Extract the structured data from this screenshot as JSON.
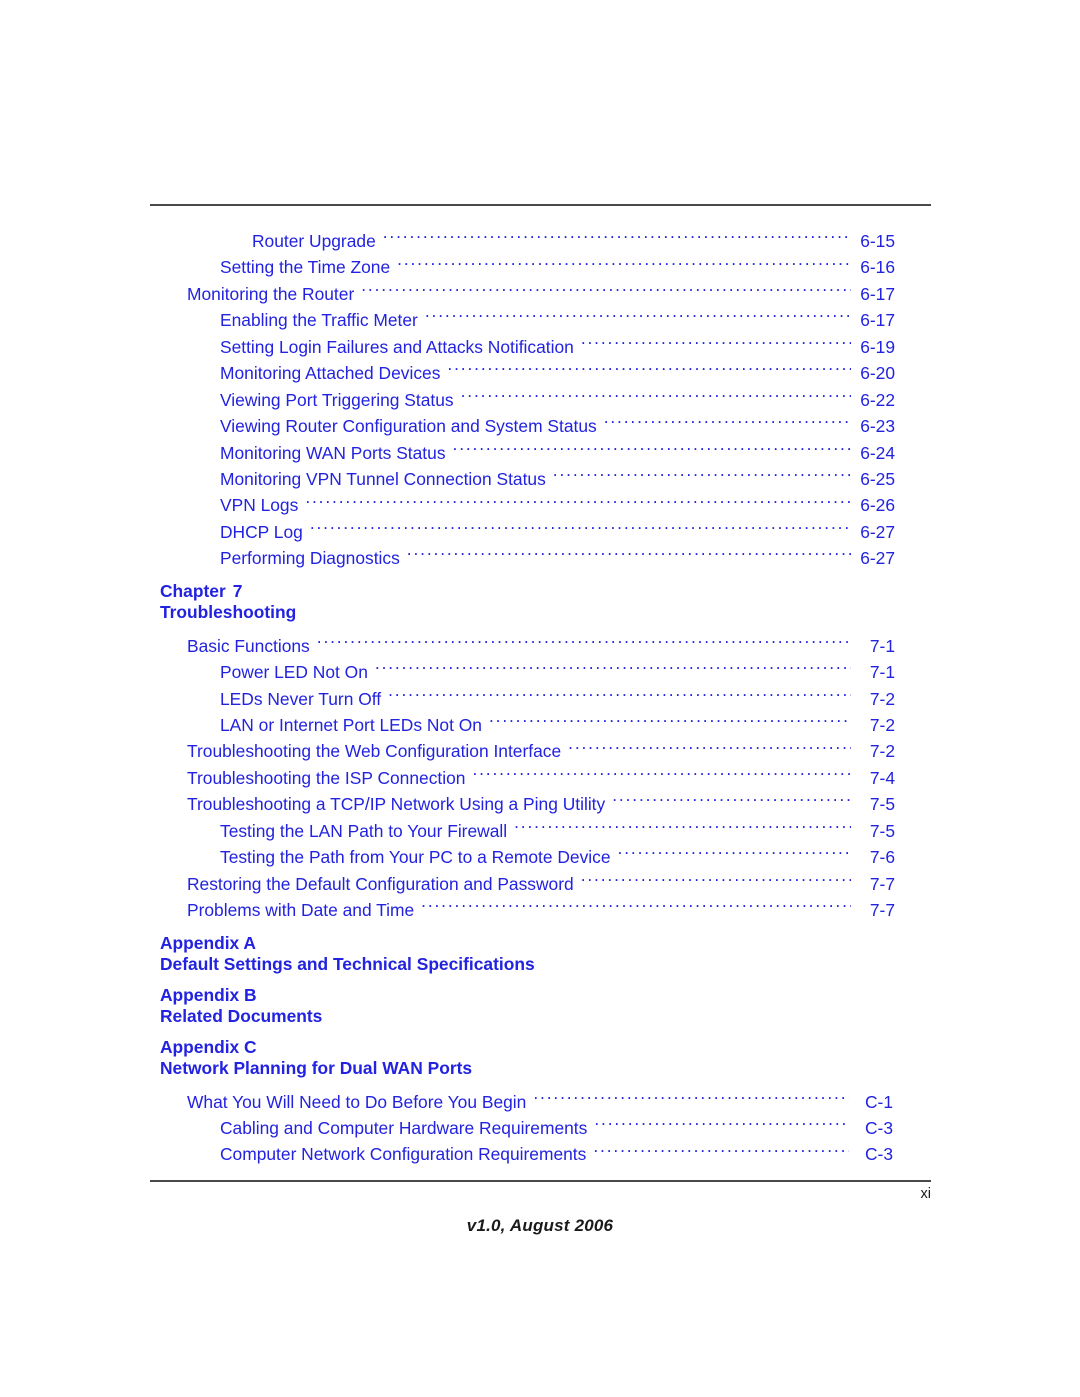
{
  "document": {
    "folio": "xi",
    "version_line": "v1.0, August 2006",
    "link_color": "#2222e0",
    "rule_color": "#4a4a4a"
  },
  "toc": {
    "entries": [
      {
        "kind": "entry",
        "level": 3,
        "title": "Router Upgrade",
        "page": "6-15"
      },
      {
        "kind": "entry",
        "level": 2,
        "title": "Setting the Time Zone",
        "page": "6-16"
      },
      {
        "kind": "entry",
        "level": 1,
        "title": "Monitoring the Router",
        "page": "6-17"
      },
      {
        "kind": "entry",
        "level": 2,
        "title": "Enabling the Traffic Meter",
        "page": "6-17"
      },
      {
        "kind": "entry",
        "level": 2,
        "title": "Setting Login Failures and Attacks Notification",
        "page": "6-19"
      },
      {
        "kind": "entry",
        "level": 2,
        "title": "Monitoring Attached Devices",
        "page": "6-20"
      },
      {
        "kind": "entry",
        "level": 2,
        "title": "Viewing Port Triggering Status",
        "page": "6-22"
      },
      {
        "kind": "entry",
        "level": 2,
        "title": "Viewing Router Configuration and System Status",
        "page": "6-23"
      },
      {
        "kind": "entry",
        "level": 2,
        "title": "Monitoring WAN Ports Status",
        "page": "6-24"
      },
      {
        "kind": "entry",
        "level": 2,
        "title": "Monitoring VPN Tunnel Connection Status",
        "page": "6-25"
      },
      {
        "kind": "entry",
        "level": 2,
        "title": "VPN Logs",
        "page": "6-26"
      },
      {
        "kind": "entry",
        "level": 2,
        "title": "DHCP Log",
        "page": "6-27"
      },
      {
        "kind": "entry",
        "level": 2,
        "title": "Performing Diagnostics",
        "page": "6-27"
      },
      {
        "kind": "heading",
        "label": "Chapter",
        "number": "7",
        "subtitle": "Troubleshooting"
      },
      {
        "kind": "entry",
        "level": 1,
        "title": "Basic Functions",
        "page": "7-1"
      },
      {
        "kind": "entry",
        "level": 2,
        "title": "Power LED Not On",
        "page": "7-1"
      },
      {
        "kind": "entry",
        "level": 2,
        "title": "LEDs Never Turn Off",
        "page": "7-2"
      },
      {
        "kind": "entry",
        "level": 2,
        "title": "LAN or Internet Port LEDs Not On",
        "page": "7-2"
      },
      {
        "kind": "entry",
        "level": 1,
        "title": "Troubleshooting the Web Configuration Interface",
        "page": "7-2"
      },
      {
        "kind": "entry",
        "level": 1,
        "title": "Troubleshooting the ISP Connection",
        "page": "7-4"
      },
      {
        "kind": "entry",
        "level": 1,
        "title": "Troubleshooting a TCP/IP Network Using a Ping Utility",
        "page": "7-5"
      },
      {
        "kind": "entry",
        "level": 2,
        "title": "Testing the LAN Path to Your Firewall",
        "page": "7-5"
      },
      {
        "kind": "entry",
        "level": 2,
        "title": "Testing the Path from Your PC to a Remote Device",
        "page": "7-6"
      },
      {
        "kind": "entry",
        "level": 1,
        "title": "Restoring the Default Configuration and Password",
        "page": "7-7"
      },
      {
        "kind": "entry",
        "level": 1,
        "title": "Problems with Date and Time",
        "page": "7-7"
      },
      {
        "kind": "heading",
        "label": "Appendix A",
        "number": "",
        "subtitle": "Default Settings and Technical Specifications"
      },
      {
        "kind": "heading",
        "label": "Appendix B",
        "number": "",
        "subtitle": "Related Documents"
      },
      {
        "kind": "heading",
        "label": "Appendix C",
        "number": "",
        "subtitle": "Network Planning for Dual WAN Ports"
      },
      {
        "kind": "entry",
        "level": 1,
        "title": "What You Will Need to Do Before You Begin",
        "page": "C-1"
      },
      {
        "kind": "entry",
        "level": 2,
        "title": "Cabling and Computer Hardware Requirements",
        "page": "C-3"
      },
      {
        "kind": "entry",
        "level": 2,
        "title": "Computer Network Configuration Requirements",
        "page": "C-3"
      }
    ]
  }
}
